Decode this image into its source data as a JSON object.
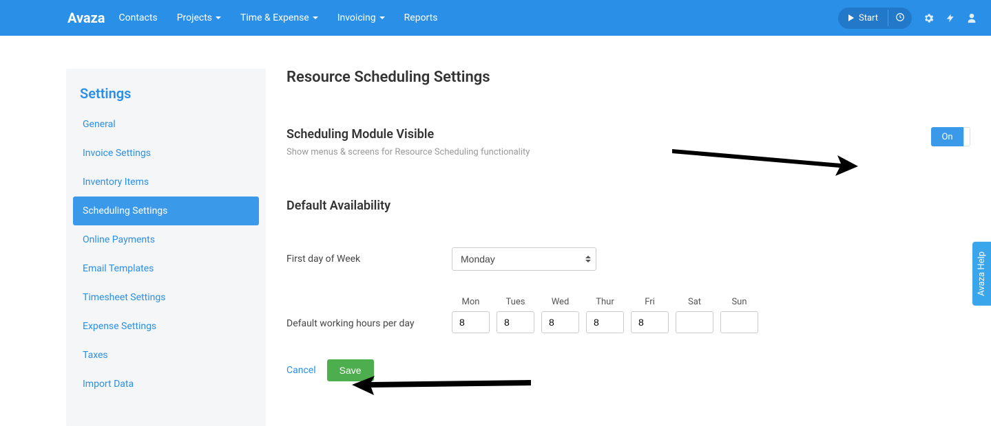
{
  "topnav": {
    "brand": "Avaza",
    "links": [
      {
        "label": "Contacts",
        "caret": false
      },
      {
        "label": "Projects",
        "caret": true
      },
      {
        "label": "Time & Expense",
        "caret": true
      },
      {
        "label": "Invoicing",
        "caret": true
      },
      {
        "label": "Reports",
        "caret": false
      }
    ],
    "start_label": "Start"
  },
  "sidebar": {
    "title": "Settings",
    "items": [
      "General",
      "Invoice Settings",
      "Inventory Items",
      "Scheduling Settings",
      "Online Payments",
      "Email Templates",
      "Timesheet Settings",
      "Expense Settings",
      "Taxes",
      "Import Data"
    ],
    "active_index": 3
  },
  "main": {
    "title": "Resource Scheduling Settings",
    "module_heading": "Scheduling Module Visible",
    "module_sub": "Show menus & screens for Resource Scheduling functionality",
    "toggle_label": "On",
    "availability_heading": "Default Availability",
    "first_day_label": "First day of Week",
    "first_day_value": "Monday",
    "hours_label": "Default working hours per day",
    "days": [
      {
        "label": "Mon",
        "value": "8"
      },
      {
        "label": "Tues",
        "value": "8"
      },
      {
        "label": "Wed",
        "value": "8"
      },
      {
        "label": "Thur",
        "value": "8"
      },
      {
        "label": "Fri",
        "value": "8"
      },
      {
        "label": "Sat",
        "value": ""
      },
      {
        "label": "Sun",
        "value": ""
      }
    ],
    "cancel_label": "Cancel",
    "save_label": "Save"
  },
  "help_tab": "Avaza Help"
}
